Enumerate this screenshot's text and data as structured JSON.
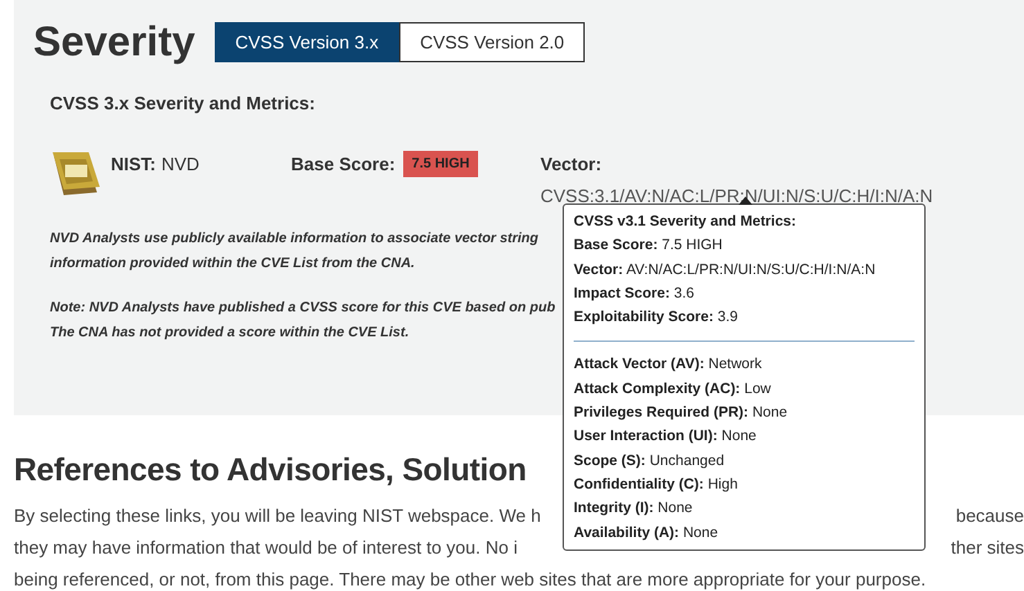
{
  "severity": {
    "title": "Severity",
    "tabs": [
      {
        "label": "CVSS Version 3.x",
        "selected": true
      },
      {
        "label": "CVSS Version 2.0",
        "selected": false
      }
    ],
    "subtitle": "CVSS 3.x Severity and Metrics:",
    "source_label": "NIST:",
    "source_value": "NVD",
    "base_score_label": "Base Score:",
    "base_score_badge": "7.5 HIGH",
    "vector_label": "Vector:",
    "vector_value": "CVSS:3.1/AV:N/AC:L/PR:N/UI:N/S:U/C:H/I:N/A:N",
    "notes": [
      [
        "NVD Analysts use publicly available information to associate vector string",
        "information provided within the CVE List from the CNA."
      ],
      [
        "Note: NVD Analysts have published a CVSS score for this CVE based on pub",
        "The CNA has not provided a score within the CVE List."
      ]
    ]
  },
  "tooltip": {
    "title": "CVSS v3.1 Severity and Metrics:",
    "scores": [
      {
        "label": "Base Score:",
        "value": "7.5 HIGH"
      },
      {
        "label": "Vector:",
        "value": "AV:N/AC:L/PR:N/UI:N/S:U/C:H/I:N/A:N"
      },
      {
        "label": "Impact Score:",
        "value": "3.6"
      },
      {
        "label": "Exploitability Score:",
        "value": "3.9"
      }
    ],
    "metrics": [
      {
        "label": "Attack Vector (AV):",
        "value": "Network"
      },
      {
        "label": "Attack Complexity (AC):",
        "value": "Low"
      },
      {
        "label": "Privileges Required (PR):",
        "value": "None"
      },
      {
        "label": "User Interaction (UI):",
        "value": "None"
      },
      {
        "label": "Scope (S):",
        "value": "Unchanged"
      },
      {
        "label": "Confidentiality (C):",
        "value": "High"
      },
      {
        "label": "Integrity (I):",
        "value": "None"
      },
      {
        "label": "Availability (A):",
        "value": "None"
      }
    ]
  },
  "references": {
    "heading": "References to Advisories, Solution",
    "lines": [
      {
        "left": "By selecting these links, you will be leaving NIST webspace. We h",
        "right": "because"
      },
      {
        "left": "they may have information that would be of interest to you. No i",
        "right": "ther sites"
      },
      {
        "left": "being referenced, or not, from this page. There may be other web sites that are more appropriate for your purpose."
      }
    ]
  }
}
